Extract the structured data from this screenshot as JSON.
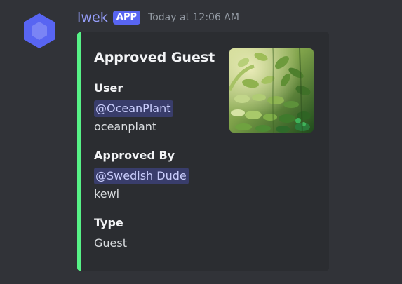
{
  "author": {
    "username": "lwek",
    "badge": "APP",
    "timestamp": "Today at 12:06 AM",
    "avatar_icon": "hexagon-bot-icon"
  },
  "embed": {
    "accent_color": "#57f287",
    "title": "Approved Guest",
    "thumbnail": "plant-image",
    "fields": [
      {
        "name": "User",
        "mention": "@OceanPlant",
        "value": "oceanplant"
      },
      {
        "name": "Approved By",
        "mention": "@Swedish Dude",
        "value": "kewi"
      },
      {
        "name": "Type",
        "value": "Guest"
      }
    ]
  },
  "colors": {
    "background": "#313338",
    "embed_background": "#2b2d31",
    "username": "#949cf7",
    "badge": "#5865f2"
  }
}
